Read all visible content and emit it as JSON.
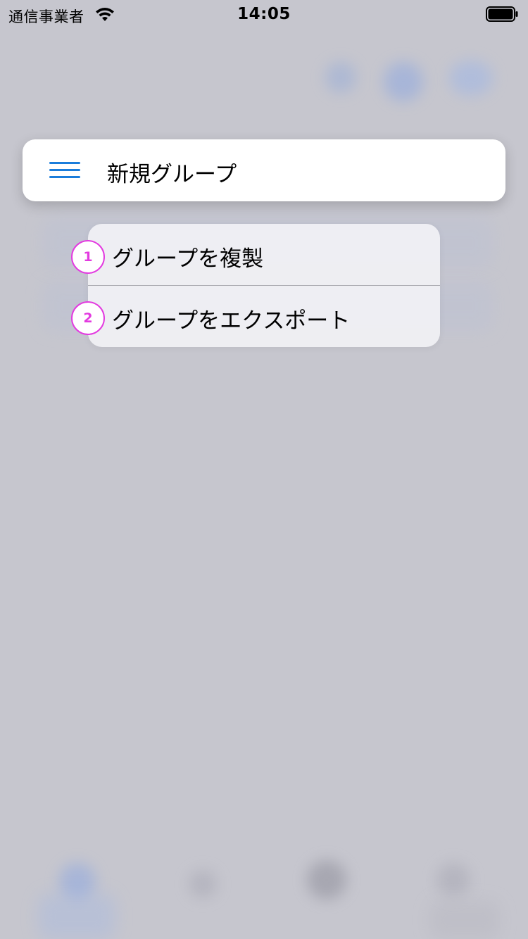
{
  "status_bar": {
    "carrier": "通信事業者",
    "time": "14:05",
    "wifi_icon": "wifi-icon",
    "battery_icon": "battery-icon"
  },
  "title_card": {
    "menu_icon": "hamburger-menu-icon",
    "title": "新規グループ",
    "accent_color": "#1b7ddb"
  },
  "context_menu": {
    "items": [
      {
        "badge": "1",
        "label": "グループを複製"
      },
      {
        "badge": "2",
        "label": "グループをエクスポート"
      }
    ]
  },
  "colors": {
    "background": "#c6c6ce",
    "badge_border": "#e33be0",
    "menu_background": "#f0f0f4"
  }
}
